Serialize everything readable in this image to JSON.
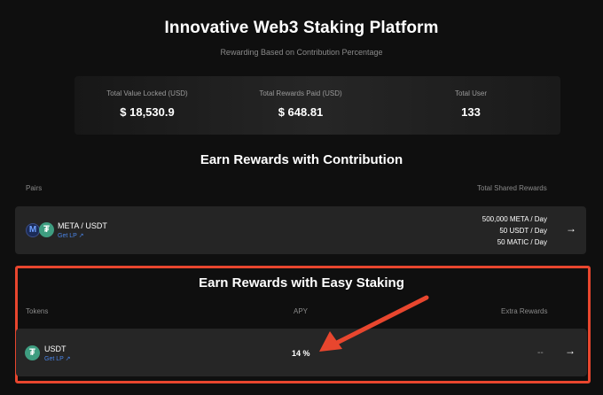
{
  "header": {
    "title": "Innovative Web3 Staking Platform",
    "subtitle": "Rewarding Based on Contribution Percentage"
  },
  "stats": [
    {
      "label": "Total Value Locked (USD)",
      "value": "$ 18,530.9"
    },
    {
      "label": "Total Rewards Paid (USD)",
      "value": "$ 648.81"
    },
    {
      "label": "Total User",
      "value": "133"
    }
  ],
  "contribution": {
    "title": "Earn Rewards with Contribution",
    "col_pairs": "Pairs",
    "col_rewards": "Total Shared Rewards",
    "pair": {
      "name": "META / USDT",
      "get_lp": "Get LP",
      "rewards": [
        "500,000 META / Day",
        "50 USDT / Day",
        "50 MATIC / Day"
      ],
      "icons": [
        "meta-token-icon",
        "tether-icon"
      ]
    }
  },
  "staking": {
    "title": "Earn Rewards with Easy Staking",
    "col_tokens": "Tokens",
    "col_apy": "APY",
    "col_extra": "Extra Rewards",
    "token": {
      "name": "USDT",
      "get_lp": "Get LP",
      "apy": "14 %",
      "extra": "--",
      "icon": "tether-icon"
    }
  },
  "glyphs": {
    "arrow": "→",
    "tether": "₮",
    "external": "↗"
  },
  "colors": {
    "highlight": "#e8462e",
    "link": "#4a84e6",
    "tether": "#3e9d80",
    "background": "#0f0f0f",
    "row": "#252525"
  }
}
